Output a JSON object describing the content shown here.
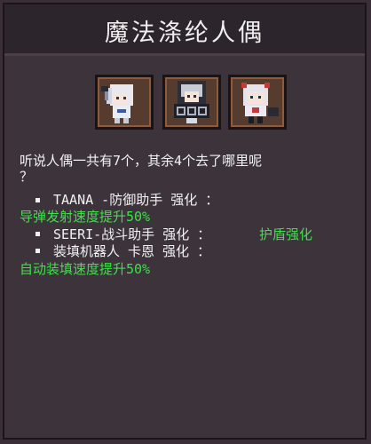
{
  "panel": {
    "title": "魔法涤纶人偶"
  },
  "portraits": [
    {
      "icon": "doll-taana-icon"
    },
    {
      "icon": "doll-seeri-icon"
    },
    {
      "icon": "doll-mech-icon"
    }
  ],
  "description": {
    "line1": "听说人偶一共有7个，其余4个去了哪里呢",
    "line2": "？"
  },
  "entries": [
    {
      "name": "TAANA -防御助手 强化 ：",
      "effect": "导弹发射速度提升50%"
    },
    {
      "name": "SEERI-战斗助手 强化 ：",
      "effect": "护盾强化"
    },
    {
      "name": "装填机器人 卡恩 强化 ：",
      "effect": "自动装填速度提升50%"
    }
  ],
  "colors": {
    "background": "#3c333b",
    "title_bar": "#2d252c",
    "highlight_green": "#3fe04b",
    "portrait_frame": "#563b2f"
  }
}
